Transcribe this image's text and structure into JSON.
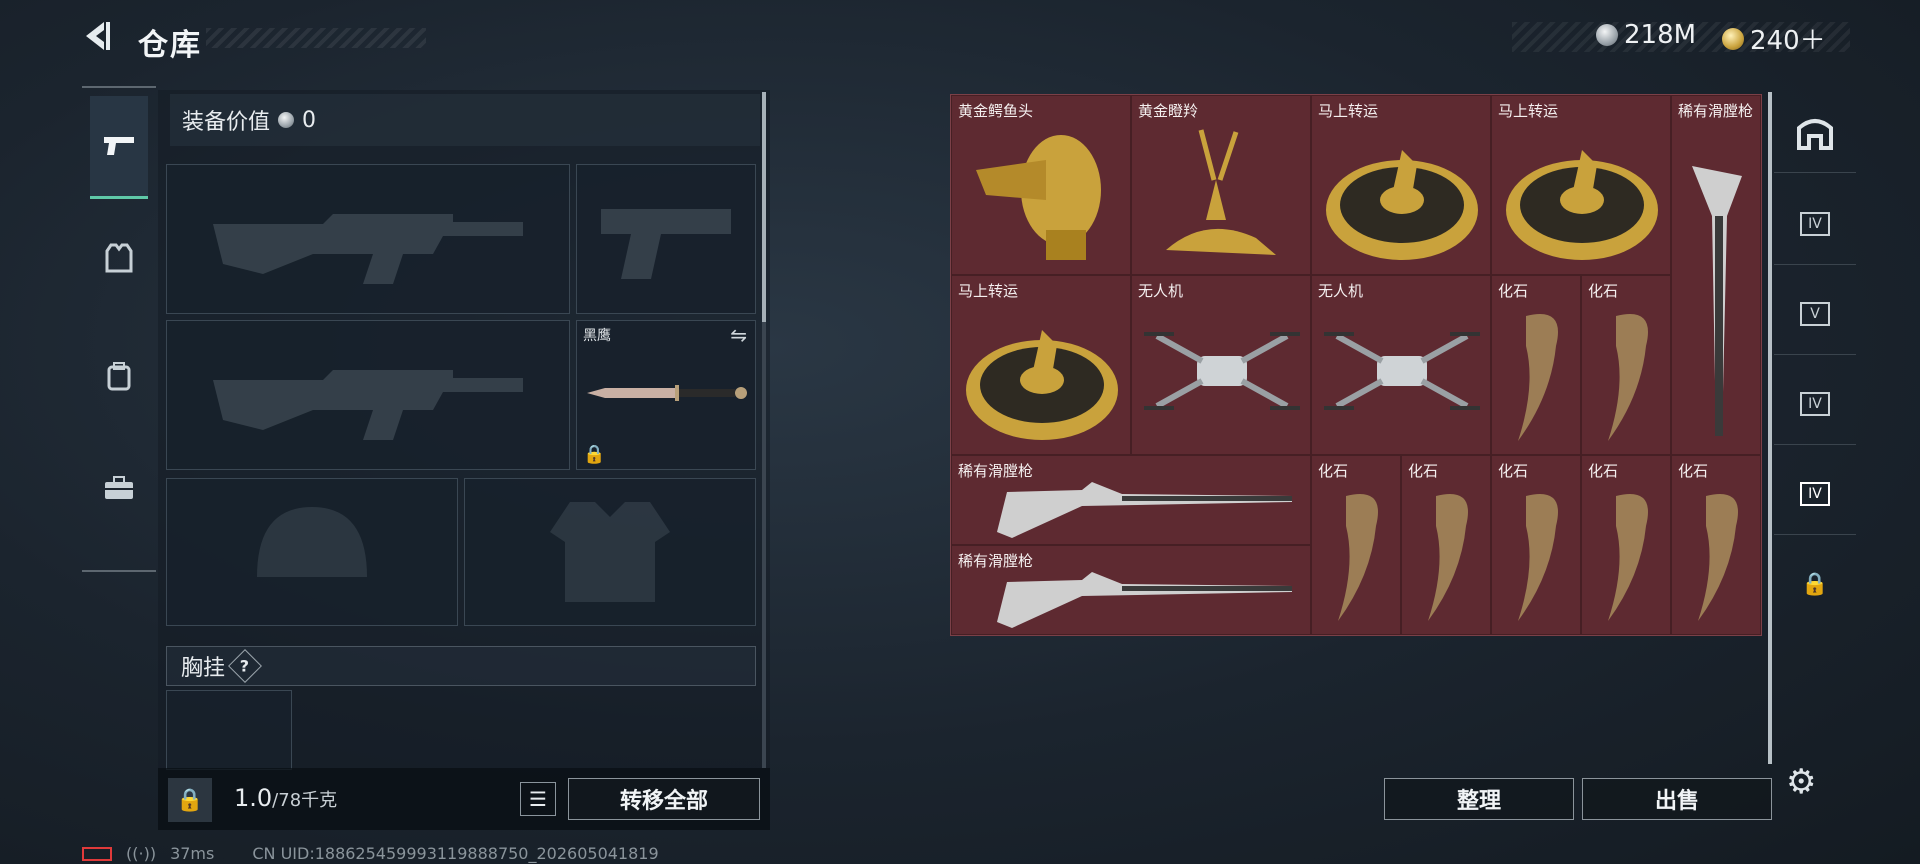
{
  "header": {
    "title": "仓库"
  },
  "currency": {
    "silver": "218M",
    "gold": "240＋"
  },
  "loadout": {
    "value_label": "装备价值",
    "value": "0",
    "knife_name": "黑鹰",
    "chest_label": "胸挂",
    "chest_help": "?",
    "weight_current": "1.0",
    "weight_max": "/78千克",
    "transfer_all": "转移全部"
  },
  "storage": {
    "items": [
      {
        "name": "黄金鳄鱼头"
      },
      {
        "name": "黄金瞪羚"
      },
      {
        "name": "马上转运"
      },
      {
        "name": "马上转运"
      },
      {
        "name": "稀有滑膛枪"
      },
      {
        "name": "马上转运"
      },
      {
        "name": "无人机"
      },
      {
        "name": "无人机"
      },
      {
        "name": "化石"
      },
      {
        "name": "化石"
      },
      {
        "name": "稀有滑膛枪"
      },
      {
        "name": "化石"
      },
      {
        "name": "化石"
      },
      {
        "name": "化石"
      },
      {
        "name": "化石"
      },
      {
        "name": "化石"
      },
      {
        "name": "稀有滑膛枪"
      }
    ],
    "sort_label": "整理",
    "sell_label": "出售"
  },
  "rail": {
    "tabs": [
      "stash-icon",
      "case-iv-icon",
      "case-v-icon",
      "case-iv-icon",
      "case-iv-icon",
      "lock-icon"
    ]
  },
  "status": {
    "ping": "37ms",
    "uid": "CN UID:188625459993119888750_202605041819"
  }
}
